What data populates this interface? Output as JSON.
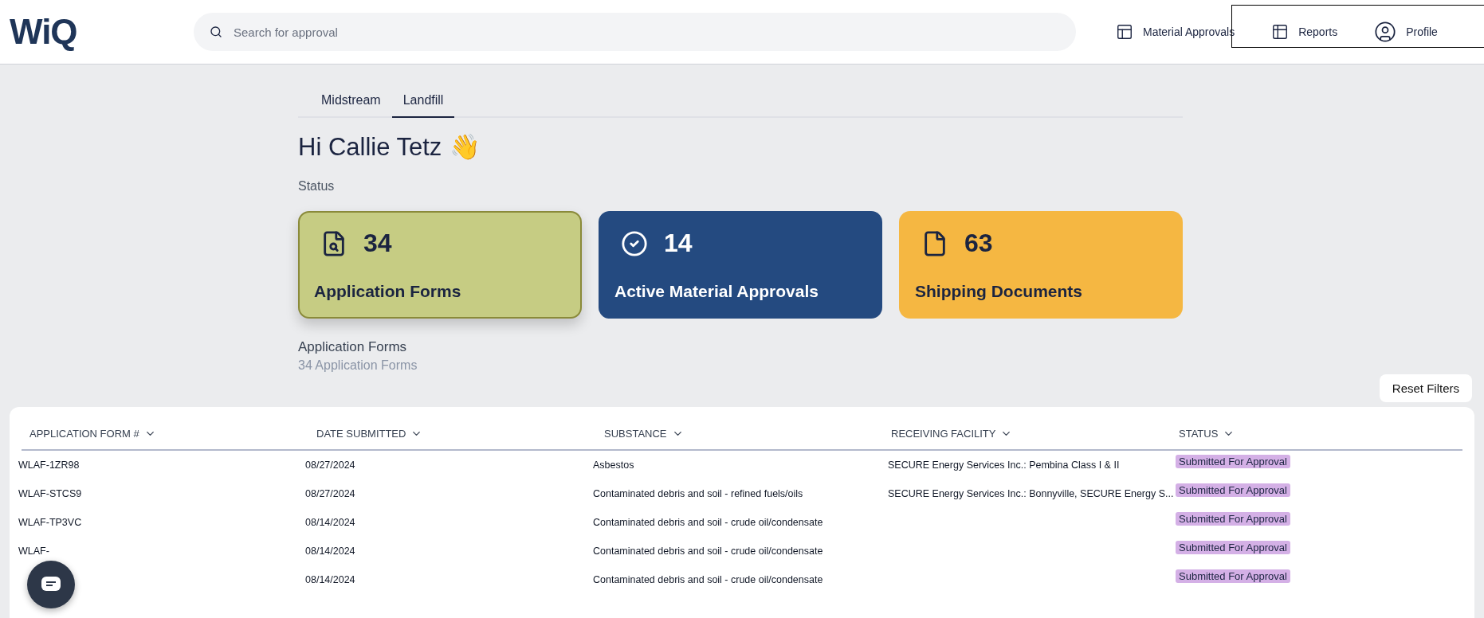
{
  "header": {
    "logo": "WiQ",
    "search": {
      "placeholder": "Search for approval"
    },
    "nav": [
      {
        "label": "Material Approvals"
      },
      {
        "label": "Reports"
      },
      {
        "label": "Profile"
      }
    ]
  },
  "tabs": [
    {
      "label": "Midstream",
      "selected": false
    },
    {
      "label": "Landfill",
      "selected": true
    }
  ],
  "greeting": {
    "text": "Hi Callie Tetz",
    "emoji": "👋"
  },
  "status_label": "Status",
  "cards": [
    {
      "count": "34",
      "label": "Application Forms",
      "color": "#c6cc83",
      "selected": true
    },
    {
      "count": "14",
      "label": "Active Material Approvals",
      "color": "#244a80",
      "selected": false
    },
    {
      "count": "63",
      "label": "Shipping Documents",
      "color": "#f5b742",
      "selected": false
    }
  ],
  "section": {
    "title": "Application Forms",
    "subtitle": "34 Application Forms"
  },
  "reset_button": "Reset Filters",
  "table": {
    "columns": [
      "APPLICATION FORM #",
      "DATE SUBMITTED",
      "SUBSTANCE",
      "RECEIVING FACILITY",
      "STATUS"
    ],
    "rows": [
      {
        "id": "WLAF-1ZR98",
        "date": "08/27/2024",
        "substance": "Asbestos",
        "facility": "SECURE Energy Services Inc.: Pembina Class I & II",
        "status": "Submitted For Approval"
      },
      {
        "id": "WLAF-STCS9",
        "date": "08/27/2024",
        "substance": "Contaminated debris and soil - refined fuels/oils",
        "facility": "SECURE Energy Services Inc.: Bonnyville, SECURE Energy S...",
        "status": "Submitted For Approval"
      },
      {
        "id": "WLAF-TP3VC",
        "date": "08/14/2024",
        "substance": "Contaminated debris and soil - crude oil/condensate",
        "status": "Submitted For Approval"
      },
      {
        "id": "WLAF-",
        "date": "08/14/2024",
        "substance": "Contaminated debris and soil - crude oil/condensate",
        "status": "Submitted For Approval"
      },
      {
        "date": "08/14/2024",
        "substance": "Contaminated debris and soil - crude oil/condensate",
        "status": "Submitted For Approval"
      }
    ]
  }
}
